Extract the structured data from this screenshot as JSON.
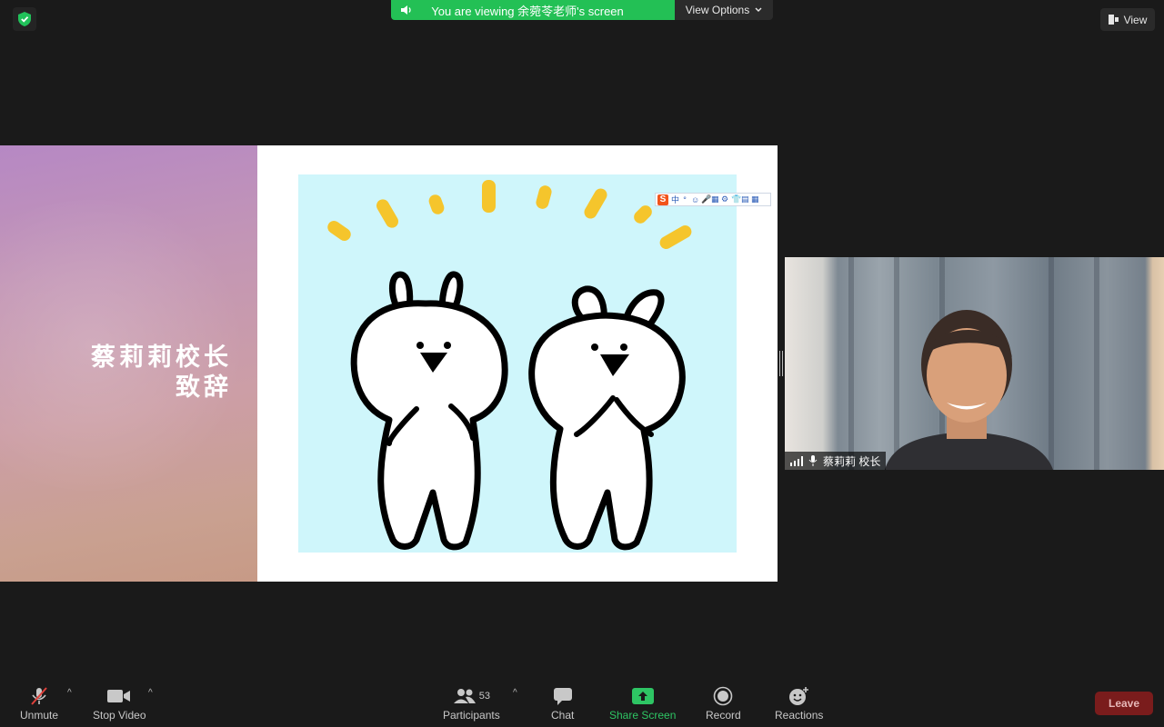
{
  "banner": {
    "viewing_text": "You are viewing 余菀苓老师's screen",
    "view_options_label": "View Options"
  },
  "top_right": {
    "view_label": "View"
  },
  "slide": {
    "title_line1": "蔡莉莉校长",
    "title_line2": "致辞"
  },
  "ime_toolbar": {
    "logo": "S",
    "mode": "中",
    "items": [
      "°",
      "☺",
      "🎤",
      "▦",
      "⚙",
      "👕",
      "▤",
      "▦"
    ]
  },
  "participant": {
    "name": "蔡莉莉 校长"
  },
  "toolbar": {
    "unmute_label": "Unmute",
    "stop_video_label": "Stop Video",
    "participants_label": "Participants",
    "participants_count": "53",
    "chat_label": "Chat",
    "share_screen_label": "Share Screen",
    "record_label": "Record",
    "reactions_label": "Reactions",
    "leave_label": "Leave"
  },
  "colors": {
    "share_green": "#23c055",
    "leave_red": "#7a1c1c",
    "background": "#1a1a1a"
  }
}
